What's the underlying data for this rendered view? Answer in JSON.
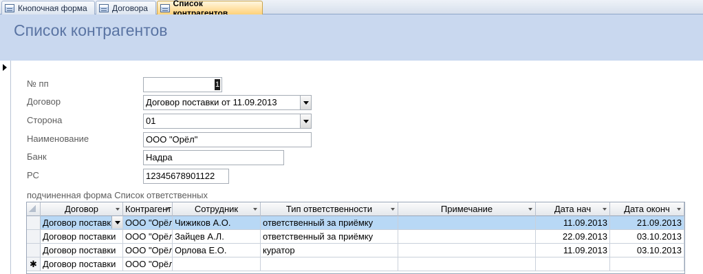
{
  "tabs": [
    {
      "label": "Кнопочная форма"
    },
    {
      "label": "Договора"
    },
    {
      "label": "Список контрагентов"
    }
  ],
  "form": {
    "title": "Список контрагентов",
    "fields": {
      "npp": {
        "label": "№ пп",
        "value": "1"
      },
      "dogovor": {
        "label": "Договор",
        "value": "Договор поставки от 11.09.2013"
      },
      "storona": {
        "label": "Сторона",
        "value": "01"
      },
      "naimenovanie": {
        "label": "Наименование",
        "value": "ООО \"Орёл\""
      },
      "bank": {
        "label": "Банк",
        "value": "Надра"
      },
      "rs": {
        "label": "РС",
        "value": "12345678901122"
      }
    }
  },
  "subform": {
    "label": "подчиненная форма Список ответственных",
    "columns": [
      "Договор",
      "Контрагент",
      "Сотрудник",
      "Тип ответственности",
      "Примечание",
      "Дата нач",
      "Дата оконч"
    ],
    "rows": [
      {
        "dogovor": "Договор поставки",
        "kontragent": "ООО \"Орёл\"",
        "sotrudnik": "Чижиков А.О.",
        "tip": "ответственный за приёмку",
        "prim": "",
        "start": "11.09.2013",
        "end": "21.09.2013",
        "selected": true
      },
      {
        "dogovor": "Договор поставки",
        "kontragent": "ООО \"Орёл\"",
        "sotrudnik": "Зайцев А.Л.",
        "tip": "ответственный за приёмку",
        "prim": "",
        "start": "22.09.2013",
        "end": "03.10.2013"
      },
      {
        "dogovor": "Договор поставки",
        "kontragent": "ООО \"Орёл\"",
        "sotrudnik": "Орлова Е.О.",
        "tip": "куратор",
        "prim": "",
        "start": "11.09.2013",
        "end": "03.10.2013"
      }
    ],
    "new_row": {
      "marker": "✱",
      "dogovor": "Договор поставки",
      "kontragent": "ООО \"Орёл\""
    }
  }
}
